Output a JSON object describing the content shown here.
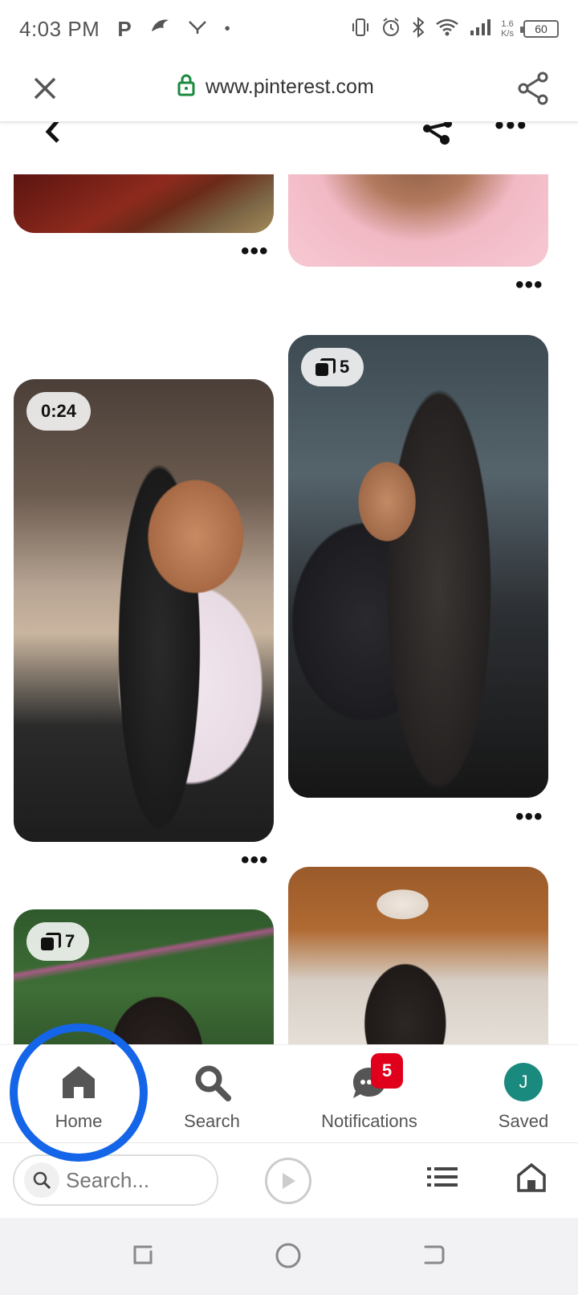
{
  "status_bar": {
    "time": "4:03 PM",
    "speed_top": "1.6",
    "speed_bottom": "K/s",
    "battery": "60"
  },
  "browser": {
    "url": "www.pinterest.com"
  },
  "pins": {
    "video_duration": "0:24",
    "carousel_count_a": "5",
    "carousel_count_b": "7",
    "more_label": "•••"
  },
  "app_tabs": {
    "home": "Home",
    "search": "Search",
    "notifications": "Notifications",
    "notifications_count": "5",
    "saved": "Saved",
    "avatar_initial": "J"
  },
  "browser_bottom": {
    "search_placeholder": "Search..."
  },
  "colors": {
    "accent_ring": "#1565e8",
    "notification_badge": "#e0001c",
    "avatar_bg": "#1a8a7e",
    "lock_green": "#1a8a3e"
  }
}
